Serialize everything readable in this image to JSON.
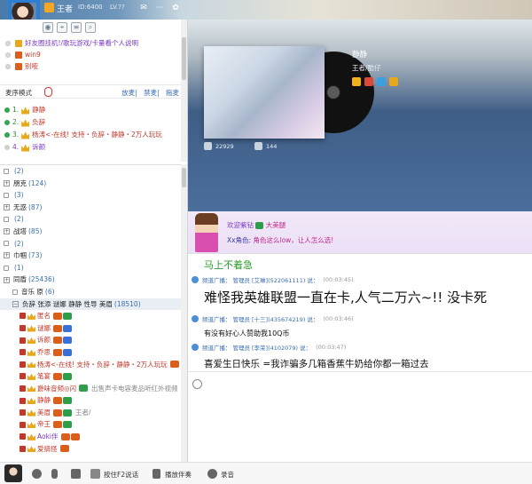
{
  "header": {
    "username": "王者",
    "id_text": "ID:6400",
    "level_text": "LV.??"
  },
  "notices": [
    {
      "label": "好友圈挂机!/歌玩游戏/卡量看个人说明"
    },
    {
      "label": "win9"
    },
    {
      "label": "别哑"
    }
  ],
  "mode": {
    "label": "麦序模式",
    "links": [
      "放麦",
      "禁麦",
      "拖麦"
    ]
  },
  "queue": [
    {
      "num": "1.",
      "name": "静静",
      "dot_color": "#2fa84f",
      "purple": false
    },
    {
      "num": "2.",
      "name": "负辞",
      "dot_color": "#2fa84f",
      "purple": false
    },
    {
      "num": "3.",
      "name": "杨涛<-在线! 支持・负辞・静静・2万人玩玩",
      "dot_color": "#2fa84f",
      "purple": false
    },
    {
      "num": "4.",
      "name": "诉颜",
      "dot_color": "#cfcfcf",
      "purple": true
    }
  ],
  "channels": [
    {
      "name": "",
      "count": "(2)",
      "kind": "lock",
      "indent": 0
    },
    {
      "name": "朋克",
      "count": "(124)",
      "kind": "expand",
      "indent": 0
    },
    {
      "name": "",
      "count": "(3)",
      "kind": "lock",
      "indent": 0
    },
    {
      "name": "无惑",
      "count": "(87)",
      "kind": "expand",
      "indent": 0
    },
    {
      "name": "",
      "count": "(2)",
      "kind": "lock",
      "indent": 0
    },
    {
      "name": "战塔",
      "count": "(85)",
      "kind": "expand",
      "indent": 0
    },
    {
      "name": "",
      "count": "(2)",
      "kind": "lock",
      "indent": 0
    },
    {
      "name": "巾帼",
      "count": "(73)",
      "kind": "expand",
      "indent": 0
    },
    {
      "name": "",
      "count": "(1)",
      "kind": "lock",
      "indent": 0
    },
    {
      "name": "同盾",
      "count": "(25436)",
      "kind": "expand",
      "indent": 0
    },
    {
      "name": "音乐 原",
      "count": "(6)",
      "kind": "lock",
      "indent": 1
    },
    {
      "name": "负辞 张添 谜娜 静静 性导 美眉",
      "count": "(18510)",
      "kind": "expand",
      "indent": 1,
      "active": true
    }
  ],
  "users": [
    {
      "name": "匿名",
      "tag": "",
      "style": "red"
    },
    {
      "name": "谜娜",
      "tag": "",
      "style": "red"
    },
    {
      "name": "诉颜",
      "tag": "",
      "style": "red"
    },
    {
      "name": "乔思",
      "tag": "",
      "style": "red"
    },
    {
      "name": "杨涛<-在线! 支持・负辞・静静・2万人玩玩",
      "tag": "",
      "style": "red"
    },
    {
      "name": "笔宴",
      "tag": "",
      "style": "red"
    },
    {
      "name": "爵味音频◎闪",
      "tag": "出售声卡电容麦品听红外视频",
      "style": "red"
    },
    {
      "name": "静静",
      "tag": "",
      "style": "red"
    },
    {
      "name": "美眉",
      "tag": "王者/",
      "style": "red"
    },
    {
      "name": "帝王",
      "tag": "",
      "style": "red"
    },
    {
      "name": "Aoki伴",
      "tag": "",
      "style": "purple"
    },
    {
      "name": "爱搞怪",
      "tag": "",
      "style": "red"
    }
  ],
  "banner": {
    "title": "静静",
    "artist": "王者/酷仔",
    "stat1": "22929",
    "stat2": "144"
  },
  "welcome": {
    "line1_a": "欢迎紫钻",
    "line1_b": "大美腿",
    "line2_a": "Xx角色:",
    "line2_b": "角色这么low，让人怎么选!"
  },
  "chat": {
    "headline": "马上不着急",
    "messages": [
      {
        "channel": "频道广播：",
        "role": "管理员",
        "user": "[艾琳](522061111)",
        "say": "说：",
        "time": "(00:03:45)",
        "body": "难怪我英雄联盟一直在卡,人气二万六~!! 没卡死",
        "size": 15
      },
      {
        "channel": "频道广播：",
        "role": "管理员",
        "user": "[十三](435674219)",
        "say": "说：",
        "time": "(00:03:46)",
        "body": "有没有好心人赞助我10Q币",
        "size": 8
      },
      {
        "channel": "频道广播：",
        "role": "管理员",
        "user": "[李荣](4102079)",
        "say": "说：",
        "time": "(00:03:47)",
        "body": "喜爱生日快乐 =我诈骗多几箱香蕉牛奶给你都一箱过去",
        "size": 10.5
      }
    ]
  },
  "bottom": {
    "push_talk": "按住F2说话",
    "accompany": "播放伴奏",
    "record": "录音"
  }
}
